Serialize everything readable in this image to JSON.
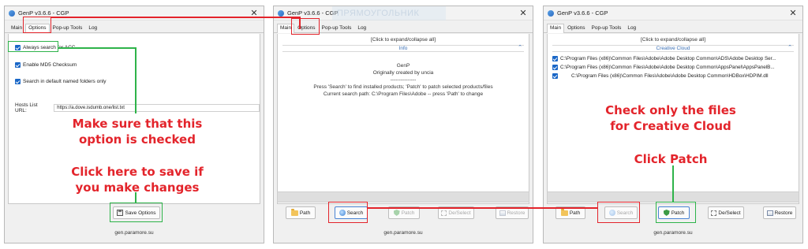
{
  "window_left": {
    "title": "GenP v3.6.6 - CGP",
    "close": "✕",
    "tabs": [
      "Main",
      "Options",
      "Pop-up Tools",
      "Log"
    ],
    "options": {
      "always_search_acc": "Always search for ACC",
      "md5_checksum": "Enable MD5 Checksum",
      "search_default_folders": "Search in default named folders only",
      "hosts_label": "Hosts List URL:",
      "hosts_value": "https://a.dove.isdumb.one/list.txt"
    },
    "save_button": "Save Options",
    "footer": "gen.paramore.su"
  },
  "window_middle": {
    "title": "GenP v3.6.6 - CGP",
    "close": "✕",
    "tabs": [
      "Main",
      "Options",
      "Pop-up Tools",
      "Log"
    ],
    "log": {
      "expand_label": "[Click to expand/collapse all]",
      "section_title": "Info",
      "lines": [
        "GenP",
        "Originally created by uncia",
        "---------------",
        "Press 'Search' to find installed products; 'Patch' to patch selected products/files",
        "Current search path: C:\\Program Files\\Adobe -- press 'Path' to change"
      ]
    },
    "buttons": {
      "path": "Path",
      "search": "Search",
      "patch": "Patch",
      "deselect": "De/Select",
      "restore": "Restore"
    },
    "footer": "gen.paramore.su",
    "watermark": "ПРЯМОУГОЛЬНИК"
  },
  "window_right": {
    "title": "GenP v3.6.6 - CGP",
    "close": "✕",
    "tabs": [
      "Main",
      "Options",
      "Pop-up Tools",
      "Log"
    ],
    "log": {
      "expand_label": "[Click to expand/collapse all]",
      "section_title": "Creative Cloud",
      "files": [
        "C:\\Program Files (x86)\\Common Files\\Adobe\\Adobe Desktop Common\\ADS\\Adobe Desktop Ser...",
        "C:\\Program Files (x86)\\Common Files\\Adobe\\Adobe Desktop Common\\AppsPanel\\AppsPanelB...",
        "C:\\Program Files (x86)\\Common Files\\Adobe\\Adobe Desktop Common\\HDBox\\HDPIM.dll"
      ]
    },
    "buttons": {
      "path": "Path",
      "search": "Search",
      "patch": "Patch",
      "deselect": "De/Select",
      "restore": "Restore"
    },
    "footer": "gen.paramore.su"
  },
  "annotations": {
    "checked_1": "Make sure that this",
    "checked_2": "option is checked",
    "save_1": "Click here to save if",
    "save_2": "you make changes",
    "check_files_1": "Check only the files",
    "check_files_2": "for Creative Cloud",
    "click_patch": "Click Patch"
  },
  "colors": {
    "annotation_red": "#e3242b",
    "annotation_green": "#2eb34a",
    "checkbox_blue": "#1a67c7",
    "link_blue": "#3a6fb5"
  }
}
